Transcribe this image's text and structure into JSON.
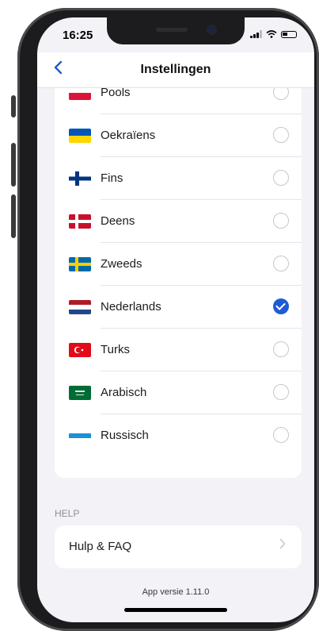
{
  "status_bar": {
    "time": "16:25"
  },
  "navbar": {
    "title": "Instellingen",
    "back_icon": "chevron-left-icon"
  },
  "languages": [
    {
      "label": "Pools",
      "flag": "poland-flag",
      "selected": false
    },
    {
      "label": "Oekraïens",
      "flag": "ukraine-flag",
      "selected": false
    },
    {
      "label": "Fins",
      "flag": "finland-flag",
      "selected": false
    },
    {
      "label": "Deens",
      "flag": "denmark-flag",
      "selected": false
    },
    {
      "label": "Zweeds",
      "flag": "sweden-flag",
      "selected": false
    },
    {
      "label": "Nederlands",
      "flag": "netherlands-flag",
      "selected": true
    },
    {
      "label": "Turks",
      "flag": "turkey-flag",
      "selected": false
    },
    {
      "label": "Arabisch",
      "flag": "saudi-arabia-flag",
      "selected": false
    },
    {
      "label": "Russisch",
      "flag": "russia-flag",
      "selected": false
    }
  ],
  "help": {
    "header": "HELP",
    "item_label": "Hulp & FAQ"
  },
  "footer": {
    "version": "App versie 1.11.0"
  },
  "colors": {
    "accent": "#1d5bd6",
    "background": "#f2f2f7",
    "card": "#ffffff"
  }
}
